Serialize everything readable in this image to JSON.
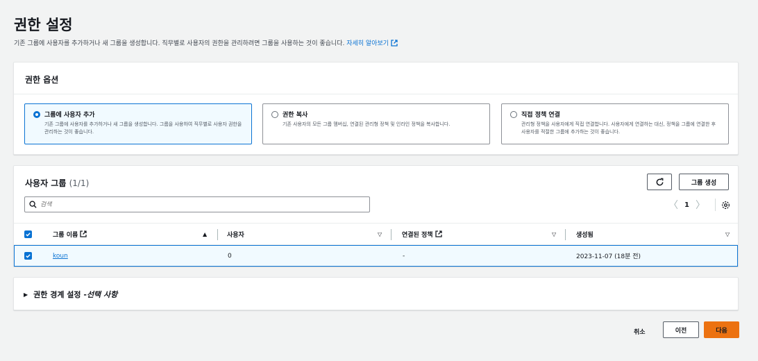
{
  "page": {
    "title": "권한 설정",
    "description": "기존 그룹에 사용자를 추가하거나 새 그룹을 생성합니다. 직무별로 사용자의 권한을 관리하려면 그룹을 사용하는 것이 좋습니다.",
    "learn_more": "자세히 알아보기"
  },
  "permission_options": {
    "title": "권한 옵션",
    "options": [
      {
        "label": "그룹에 사용자 추가",
        "description": "기존 그룹에 사용자를 추가하거나 새 그룹을 생성합니다. 그룹을 사용하여 직무별로 사용자 권한을 관리하는 것이 좋습니다.",
        "selected": true
      },
      {
        "label": "권한 복사",
        "description": "기존 사용자의 모든 그룹 멤버십, 연결된 관리형 정책 및 인라인 정책을 복사합니다.",
        "selected": false
      },
      {
        "label": "직접 정책 연결",
        "description": "관리형 정책을 사용자에게 직접 연결합니다. 사용자에게 연결하는 대신, 정책을 그룹에 연결한 후 사용자를 적절한 그룹에 추가하는 것이 좋습니다.",
        "selected": false
      }
    ]
  },
  "user_groups": {
    "title": "사용자 그룹",
    "count": "(1/1)",
    "create_button": "그룹 생성",
    "search_placeholder": "검색",
    "page_number": "1",
    "columns": {
      "group_name": "그룹 이름",
      "users": "사용자",
      "attached_policies": "연결된 정책",
      "created": "생성됨"
    },
    "rows": [
      {
        "group_name": "koun",
        "users": "0",
        "attached_policies": "-",
        "created": "2023-11-07 (18분 전)"
      }
    ]
  },
  "boundary": {
    "title": "권한 경계 설정 - ",
    "optional": "선택 사항"
  },
  "footer": {
    "cancel": "취소",
    "previous": "이전",
    "next": "다음"
  },
  "colors": {
    "primary": "#0972d3",
    "accent": "#ec7211"
  }
}
